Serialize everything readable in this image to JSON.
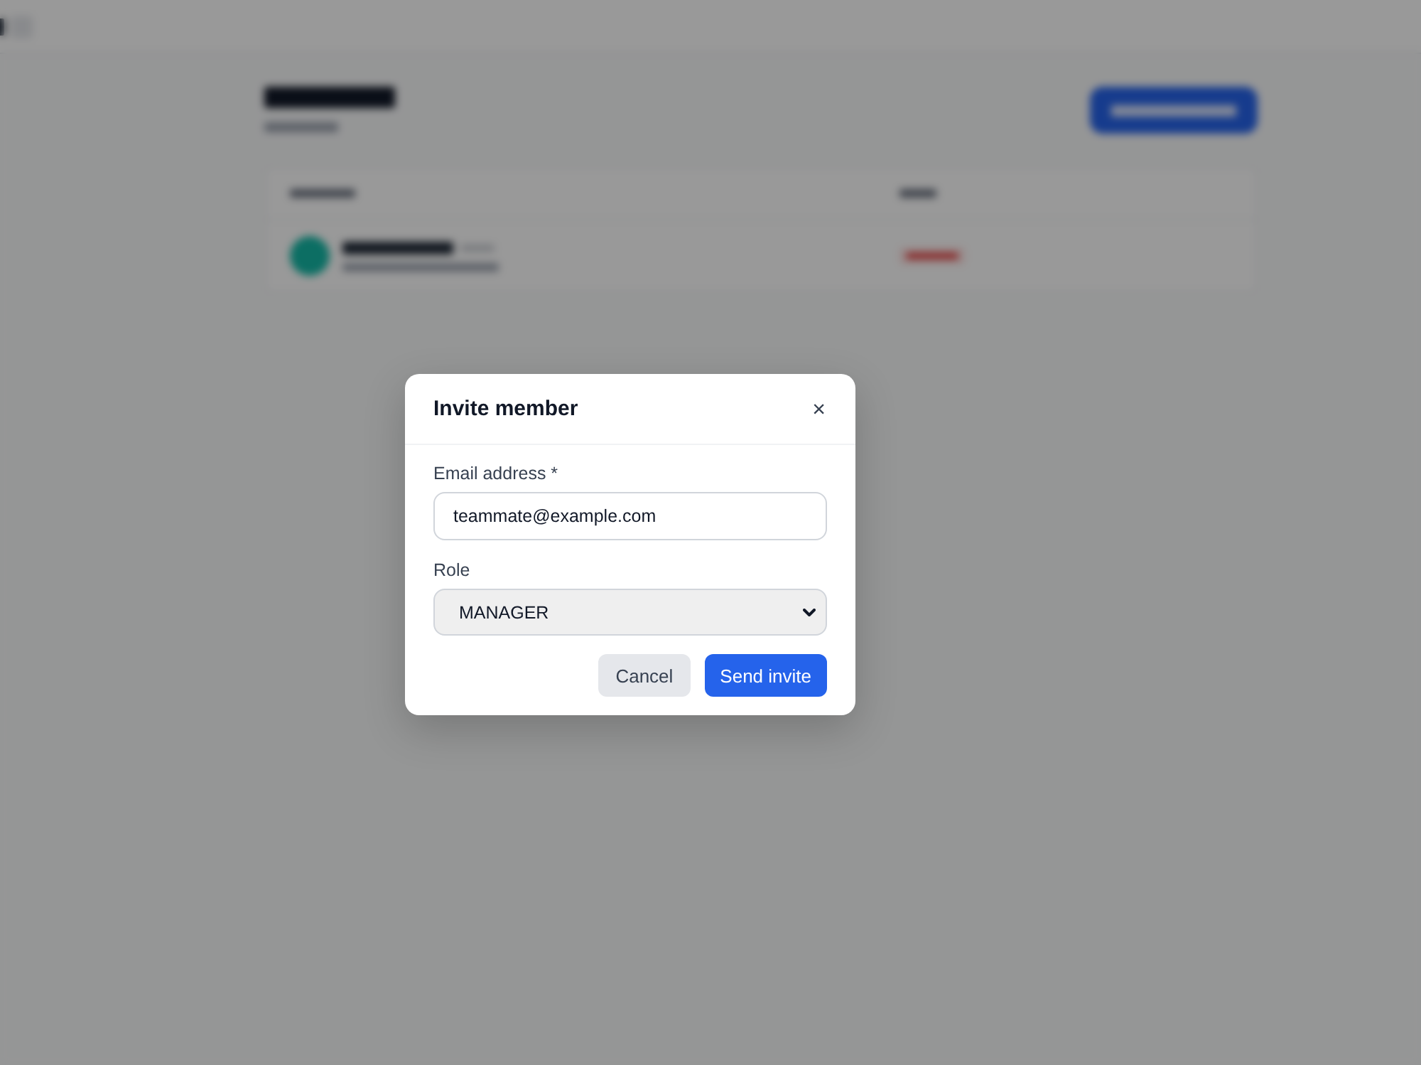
{
  "backdrop": {
    "blurred": true
  },
  "modal": {
    "title": "Invite member",
    "close": "×",
    "fields": [
      {
        "kind": "text",
        "label": "Email address *",
        "value": "teammate@example.com"
      },
      {
        "kind": "select",
        "label": "Role",
        "value": "MANAGER"
      }
    ],
    "buttons": [
      {
        "kind": "secondary",
        "label": "Cancel"
      },
      {
        "kind": "primary",
        "label": "Send invite"
      }
    ]
  }
}
